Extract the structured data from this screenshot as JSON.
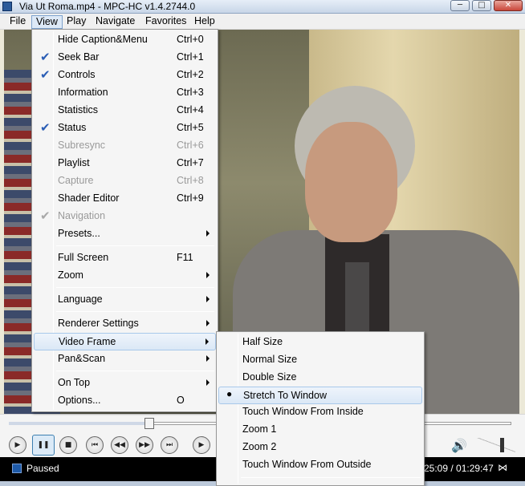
{
  "window": {
    "title": "Via Ut Roma.mp4 - MPC-HC v1.4.2744.0",
    "min_label": "─",
    "max_label": "□",
    "close_label": "✕"
  },
  "menubar": {
    "items": [
      "File",
      "View",
      "Play",
      "Navigate",
      "Favorites",
      "Help"
    ],
    "active": "View"
  },
  "view_menu": {
    "items": [
      {
        "label": "Hide Caption&Menu",
        "shortcut": "Ctrl+0",
        "checked": false,
        "enabled": true
      },
      {
        "label": "Seek Bar",
        "shortcut": "Ctrl+1",
        "checked": true,
        "enabled": true
      },
      {
        "label": "Controls",
        "shortcut": "Ctrl+2",
        "checked": true,
        "enabled": true
      },
      {
        "label": "Information",
        "shortcut": "Ctrl+3",
        "checked": false,
        "enabled": true
      },
      {
        "label": "Statistics",
        "shortcut": "Ctrl+4",
        "checked": false,
        "enabled": true
      },
      {
        "label": "Status",
        "shortcut": "Ctrl+5",
        "checked": true,
        "enabled": true
      },
      {
        "label": "Subresync",
        "shortcut": "Ctrl+6",
        "checked": false,
        "enabled": false
      },
      {
        "label": "Playlist",
        "shortcut": "Ctrl+7",
        "checked": false,
        "enabled": true
      },
      {
        "label": "Capture",
        "shortcut": "Ctrl+8",
        "checked": false,
        "enabled": false
      },
      {
        "label": "Shader Editor",
        "shortcut": "Ctrl+9",
        "checked": false,
        "enabled": true
      },
      {
        "label": "Navigation",
        "shortcut": "",
        "checked": true,
        "enabled": false
      },
      {
        "label": "Presets...",
        "shortcut": "",
        "submenu": true
      },
      {
        "label": "Full Screen",
        "shortcut": "F11"
      },
      {
        "label": "Zoom",
        "shortcut": "",
        "submenu": true
      },
      {
        "label": "Language",
        "shortcut": "",
        "submenu": true
      },
      {
        "label": "Renderer Settings",
        "shortcut": "",
        "submenu": true
      },
      {
        "label": "Video Frame",
        "shortcut": "",
        "submenu": true,
        "highlighted": true
      },
      {
        "label": "Pan&Scan",
        "shortcut": "",
        "submenu": true
      },
      {
        "label": "On Top",
        "shortcut": "",
        "submenu": true
      },
      {
        "label": "Options...",
        "shortcut": "O"
      }
    ]
  },
  "video_frame_menu": {
    "items": [
      {
        "label": "Half Size"
      },
      {
        "label": "Normal Size"
      },
      {
        "label": "Double Size"
      },
      {
        "label": "Stretch To Window",
        "selected": true
      },
      {
        "label": "Touch Window From Inside"
      },
      {
        "label": "Zoom 1"
      },
      {
        "label": "Zoom 2"
      },
      {
        "label": "Touch Window From Outside"
      }
    ]
  },
  "controls": {
    "buttons": [
      {
        "name": "play",
        "glyph": "▶"
      },
      {
        "name": "pause",
        "glyph": "❚❚"
      },
      {
        "name": "stop",
        "glyph": "■"
      },
      {
        "name": "previous",
        "glyph": "⏮"
      },
      {
        "name": "rewind",
        "glyph": "◀◀"
      },
      {
        "name": "forward",
        "glyph": "▶▶"
      },
      {
        "name": "next",
        "glyph": "⏭"
      },
      {
        "name": "frame-step",
        "glyph": "▶"
      }
    ],
    "seek_position": 0.28,
    "volume_level": 0.65,
    "volume_icon": "🔊"
  },
  "status": {
    "text": "Paused",
    "time": "25:09 / 01:29:47",
    "audio_icon": "⋈"
  }
}
